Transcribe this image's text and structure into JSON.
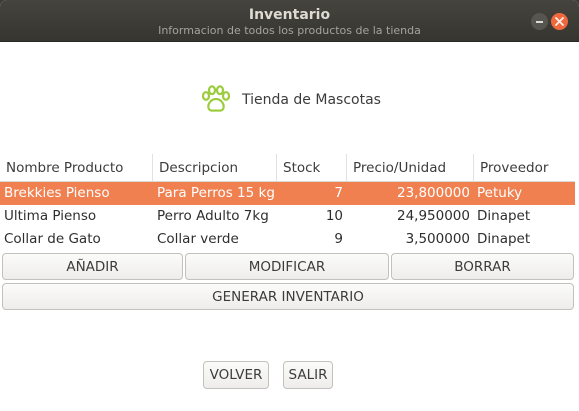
{
  "window": {
    "title": "Inventario",
    "subtitle": "Informacion de todos los productos de la tienda"
  },
  "store": {
    "name": "Tienda de Mascotas",
    "icon": "paw-icon",
    "icon_color": "#9ccc3c"
  },
  "table": {
    "columns": [
      "Nombre Producto",
      "Descripcion",
      "Stock",
      "Precio/Unidad",
      "Proveedor"
    ],
    "rows": [
      [
        "Brekkies Pienso",
        "Para Perros 15 kg",
        "7",
        "23,800000",
        "Petuky"
      ],
      [
        "Ultima Pienso",
        "Perro Adulto 7kg",
        "10",
        "24,950000",
        "Dinapet"
      ],
      [
        "Collar de Gato",
        "Collar verde",
        "9",
        "3,500000",
        "Dinapet"
      ]
    ],
    "selected_row": 0,
    "selection_color": "#f08050"
  },
  "buttons": {
    "add": "AÑADIR",
    "modify": "MODIFICAR",
    "delete": "BORRAR",
    "generate": "GENERAR INVENTARIO",
    "back": "VOLVER",
    "exit": "SALIR"
  }
}
